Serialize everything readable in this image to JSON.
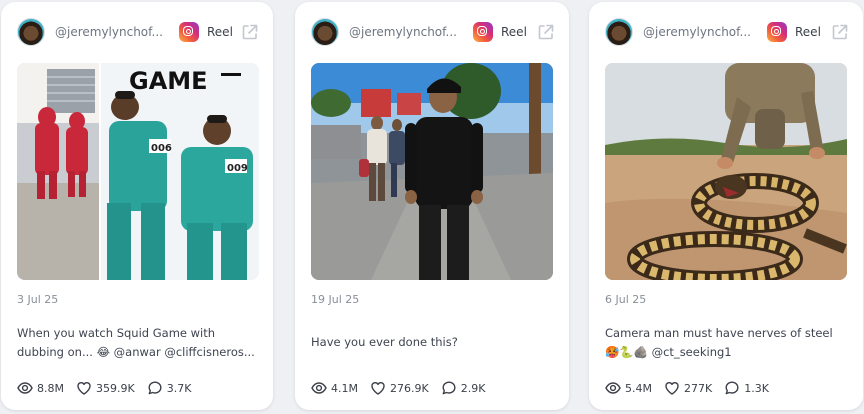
{
  "cards": [
    {
      "handle": "@jeremylynchof...",
      "type_label": "Reel",
      "media_text": "GAME",
      "jersey_numbers": [
        "006",
        "009"
      ],
      "date": "3 Jul 25",
      "caption": "When you watch Squid Game with dubbing on... 😂 @anwar @cliffcisneros...",
      "views": "8.8M",
      "likes": "359.9K",
      "comments": "3.7K"
    },
    {
      "handle": "@jeremylynchof...",
      "type_label": "Reel",
      "date": "19 Jul 25",
      "caption": "Have you ever done this?",
      "views": "4.1M",
      "likes": "276.9K",
      "comments": "2.9K"
    },
    {
      "handle": "@jeremylynchof...",
      "type_label": "Reel",
      "date": "6 Jul 25",
      "caption": "Camera man must have nerves of steel 🥵🐍🪨 @ct_seeking1",
      "views": "5.4M",
      "likes": "277K",
      "comments": "1.3K"
    }
  ],
  "icons": {
    "platform": "instagram-icon",
    "external": "external-link-icon",
    "views": "eye-icon",
    "likes": "heart-icon",
    "comments": "comment-icon"
  },
  "colors": {
    "page_bg": "#eef0f4",
    "card_bg": "#ffffff",
    "muted_text": "#8a8f99",
    "body_text": "#3f4450"
  }
}
